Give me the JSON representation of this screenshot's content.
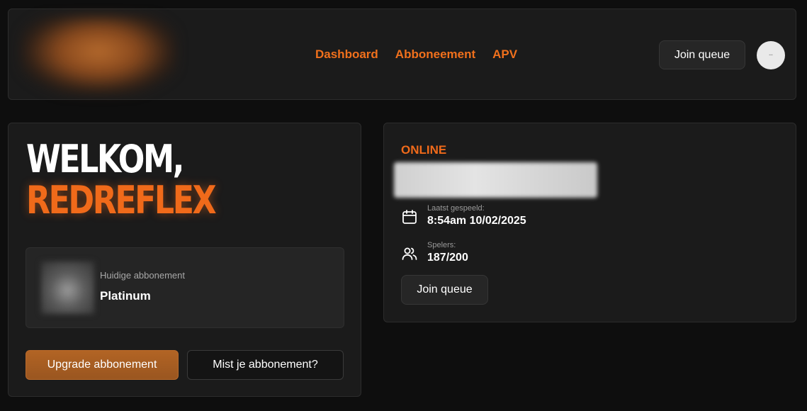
{
  "nav": {
    "links": [
      "Dashboard",
      "Abboneement",
      "APV"
    ],
    "join_label": "Join queue"
  },
  "welcome": {
    "line1": "WELKOM,",
    "line2": "REDREFLEX",
    "subscription_label": "Huidige abbonement",
    "subscription_value": "Platinum",
    "upgrade_label": "Upgrade abbonement",
    "missing_label": "Mist je abbonement?"
  },
  "server": {
    "status": "ONLINE",
    "last_played_label": "Laatst gespeeld:",
    "last_played_value": "8:54am 10/02/2025",
    "players_label": "Spelers:",
    "players_value": "187/200",
    "join_label": "Join queue"
  },
  "colors": {
    "accent": "#f06a1a",
    "background": "#0e0e0e",
    "card": "#1b1b1b"
  },
  "icons": [
    "calendar-icon",
    "users-icon"
  ]
}
